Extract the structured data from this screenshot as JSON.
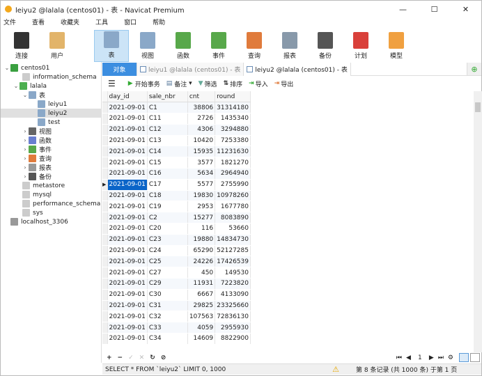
{
  "window": {
    "title": "leiyu2 @lalala (centos01) - 表 - Navicat Premium",
    "min": "—",
    "max": "☐",
    "close": "✕"
  },
  "menu": [
    "文件",
    "查看",
    "收藏夹",
    "工具",
    "窗口",
    "帮助"
  ],
  "toolbar": [
    {
      "label": "连接",
      "icon": "connection-icon",
      "color": "#333"
    },
    {
      "label": "用户",
      "icon": "user-icon",
      "color": "#e2b46a"
    },
    {
      "label": "表",
      "icon": "table-icon",
      "color": "#8aa8c8",
      "active": true
    },
    {
      "label": "视图",
      "icon": "view-icon",
      "color": "#8aa8c8"
    },
    {
      "label": "函数",
      "icon": "function-icon",
      "color": "#58a84a"
    },
    {
      "label": "事件",
      "icon": "event-icon",
      "color": "#58a84a"
    },
    {
      "label": "查询",
      "icon": "query-icon",
      "color": "#e07b3c"
    },
    {
      "label": "报表",
      "icon": "report-icon",
      "color": "#8899aa"
    },
    {
      "label": "备份",
      "icon": "backup-icon",
      "color": "#555"
    },
    {
      "label": "计划",
      "icon": "schedule-icon",
      "color": "#d9403a"
    },
    {
      "label": "模型",
      "icon": "model-icon",
      "color": "#f0a040"
    }
  ],
  "tree": [
    {
      "label": "centos01",
      "level": 0,
      "arrow": "⌄",
      "color": "#3aa040"
    },
    {
      "label": "information_schema",
      "level": 1,
      "arrow": "",
      "color": "#ccc"
    },
    {
      "label": "lalala",
      "level": 1,
      "arrow": "⌄",
      "color": "#4caf50"
    },
    {
      "label": "表",
      "level": 2,
      "arrow": "⌄",
      "color": "#8aa8c8"
    },
    {
      "label": "leiyu1",
      "level": 3,
      "arrow": "",
      "color": "#8aa8c8"
    },
    {
      "label": "leiyu2",
      "level": 3,
      "arrow": "",
      "color": "#8aa8c8",
      "selected": true
    },
    {
      "label": "test",
      "level": 3,
      "arrow": "",
      "color": "#8aa8c8"
    },
    {
      "label": "视图",
      "level": 2,
      "arrow": "›",
      "color": "#666"
    },
    {
      "label": "函数",
      "level": 2,
      "arrow": "›",
      "color": "#6a7fd0"
    },
    {
      "label": "事件",
      "level": 2,
      "arrow": "›",
      "color": "#58a84a"
    },
    {
      "label": "查询",
      "level": 2,
      "arrow": "›",
      "color": "#e07b3c"
    },
    {
      "label": "报表",
      "level": 2,
      "arrow": "›",
      "color": "#999"
    },
    {
      "label": "备份",
      "level": 2,
      "arrow": "›",
      "color": "#555"
    },
    {
      "label": "metastore",
      "level": 1,
      "arrow": "",
      "color": "#ccc"
    },
    {
      "label": "mysql",
      "level": 1,
      "arrow": "",
      "color": "#ccc"
    },
    {
      "label": "performance_schema",
      "level": 1,
      "arrow": "",
      "color": "#ccc"
    },
    {
      "label": "sys",
      "level": 1,
      "arrow": "",
      "color": "#ccc"
    },
    {
      "label": "localhost_3306",
      "level": 0,
      "arrow": "",
      "color": "#999"
    }
  ],
  "tabs": {
    "objects": "对象",
    "tab1": "leiyu1 @lalala (centos01) - 表",
    "tab2": "leiyu2 @lalala (centos01) - 表"
  },
  "grid_toolbar": {
    "begin_tx": "开始事务",
    "note": "备注",
    "filter": "筛选",
    "sort": "排序",
    "import": "导入",
    "export": "导出"
  },
  "columns": [
    "day_id",
    "sale_nbr",
    "cnt",
    "round"
  ],
  "rows": [
    [
      "2021-09-01",
      "C1",
      "38806",
      "31314180"
    ],
    [
      "2021-09-01",
      "C11",
      "2726",
      "1435340"
    ],
    [
      "2021-09-01",
      "C12",
      "4306",
      "3294880"
    ],
    [
      "2021-09-01",
      "C13",
      "10420",
      "7253380"
    ],
    [
      "2021-09-01",
      "C14",
      "15935",
      "11231630"
    ],
    [
      "2021-09-01",
      "C15",
      "3577",
      "1821270"
    ],
    [
      "2021-09-01",
      "C16",
      "5634",
      "2964940"
    ],
    [
      "2021-09-01",
      "C17",
      "5577",
      "2755990"
    ],
    [
      "2021-09-01",
      "C18",
      "19830",
      "10978260"
    ],
    [
      "2021-09-01",
      "C19",
      "2953",
      "1677780"
    ],
    [
      "2021-09-01",
      "C2",
      "15277",
      "8083890"
    ],
    [
      "2021-09-01",
      "C20",
      "116",
      "53660"
    ],
    [
      "2021-09-01",
      "C23",
      "19880",
      "14834730"
    ],
    [
      "2021-09-01",
      "C24",
      "65290",
      "52127285"
    ],
    [
      "2021-09-01",
      "C25",
      "24226",
      "17426539"
    ],
    [
      "2021-09-01",
      "C27",
      "450",
      "149530"
    ],
    [
      "2021-09-01",
      "C29",
      "11931",
      "7223820"
    ],
    [
      "2021-09-01",
      "C30",
      "6667",
      "4133090"
    ],
    [
      "2021-09-01",
      "C31",
      "29825",
      "23325660"
    ],
    [
      "2021-09-01",
      "C32",
      "107563",
      "72836130"
    ],
    [
      "2021-09-01",
      "C33",
      "4059",
      "2955930"
    ],
    [
      "2021-09-01",
      "C34",
      "14609",
      "8822900"
    ]
  ],
  "selected_row": 7,
  "nav": {
    "page": "1"
  },
  "status": {
    "sql": "SELECT * FROM `leiyu2` LIMIT 0, 1000",
    "records": "第 8 条记录 (共 1000 条) 于第 1 页"
  }
}
